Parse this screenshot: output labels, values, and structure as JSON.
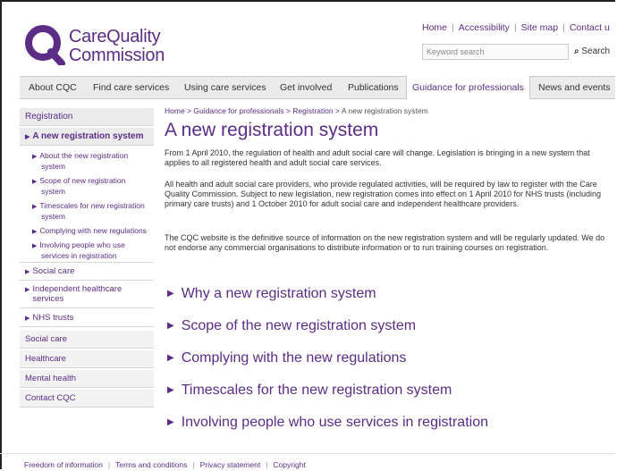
{
  "logo": {
    "line1": "CareQuality",
    "line2": "Commission"
  },
  "utility_links": [
    "Home",
    "Accessibility",
    "Site map",
    "Contact u"
  ],
  "search": {
    "placeholder": "Keyword search",
    "button_label": "Search"
  },
  "nav": [
    "About CQC",
    "Find care services",
    "Using care services",
    "Get involved",
    "Publications",
    "Guidance for professionals",
    "News and events"
  ],
  "nav_active": "Guidance for professionals",
  "sidebar": {
    "header": "Registration",
    "active": "A new registration system",
    "sub_items": [
      [
        "About the new registration",
        "system"
      ],
      [
        "Scope of new registration",
        "system"
      ],
      [
        "Timescales for new registration",
        "system"
      ],
      [
        "Complying with new regulations"
      ],
      [
        "Involving people who use",
        "services in registration"
      ]
    ],
    "section_items": [
      "Social care",
      "Independent healthcare services",
      "NHS trusts"
    ],
    "bottom_items": [
      "Social care",
      "Healthcare",
      "Mental health",
      "Contact CQC"
    ]
  },
  "breadcrumb": {
    "items": [
      "Home",
      "Guidance for professionals",
      "Registration"
    ],
    "separator": ">",
    "current": "A new registration system"
  },
  "page_title": "A new registration system",
  "paragraphs": [
    "From 1 April 2010, the regulation of health and adult social care will change. Legislation is bringing in a new system that applies to all registered health and adult social care services.",
    "All health and adult social care providers, who provide regulated activities, will be required by law to register with the Care Quality Commission. Subject to new legislation, new registration comes into effect on 1 April 2010 for NHS trusts (including primary care trusts) and 1 October 2010 for adult social care and independent healthcare providers.",
    "The CQC website is the definitive source of information on the new registration system and will be regularly updated. We do not endorse any commercial organisations to distribute information or to run training courses on registration."
  ],
  "content_links": [
    "Why a new registration system",
    "Scope of the new registration system",
    "Complying with the new regulations",
    "Timescales for the new registration system",
    "Involving people who use services in registration"
  ],
  "footer": [
    "Freedom of information",
    "Terms and conditions",
    "Privacy statement",
    "Copyright"
  ],
  "colors": {
    "brand": "#5b2d86",
    "nav_bg": "#ebebeb"
  }
}
